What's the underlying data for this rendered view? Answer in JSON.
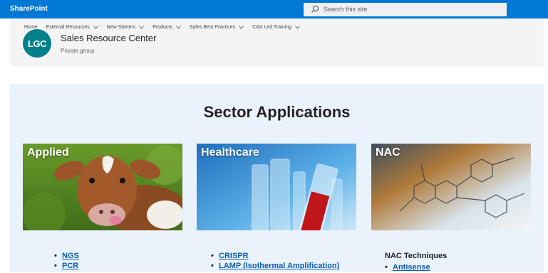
{
  "suitebar": {
    "brand": "SharePoint",
    "search_placeholder": "Search this site",
    "colors": {
      "bar": "#0078d4"
    }
  },
  "site": {
    "nav": [
      "Home",
      "External Resources",
      "New Starters",
      "Products",
      "Sales Best Practices",
      "CAS Led Training"
    ],
    "logo_text": "LGC",
    "title": "Sales Resource Center",
    "subtitle": "Private group",
    "logo_color": "#00808a"
  },
  "main": {
    "heading": "Sector Applications",
    "cards": [
      {
        "label": "Applied",
        "image": "calf-photo"
      },
      {
        "label": "Healthcare",
        "image": "test-tubes-photo"
      },
      {
        "label": "NAC",
        "image": "molecule-structure-photo"
      }
    ],
    "applied_links": [
      "NGS",
      "PCR"
    ],
    "healthcare_links": [
      "CRISPR",
      "LAMP (Isothermal Amplification)"
    ],
    "nac_heading": "NAC Techniques",
    "nac_links": [
      "Antisense"
    ]
  }
}
